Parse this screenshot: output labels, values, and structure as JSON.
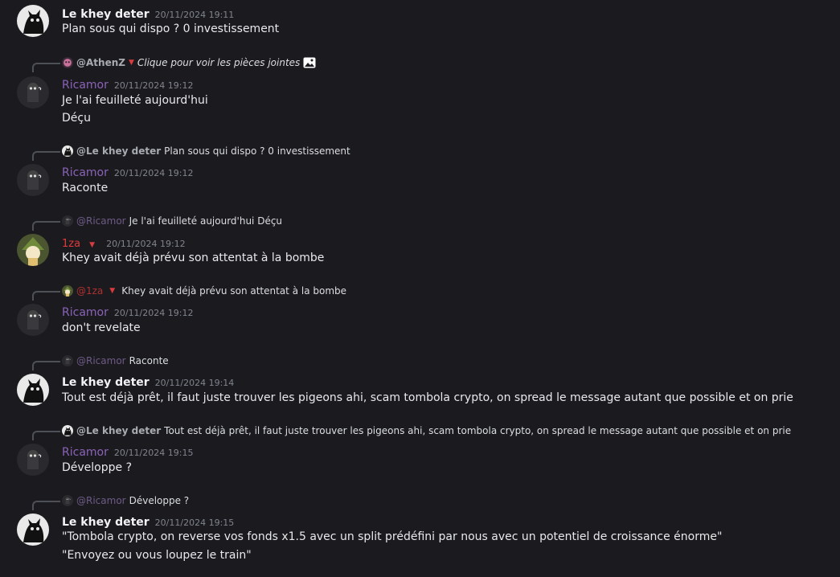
{
  "messages": [
    {
      "author": "Le khey deter",
      "time": "20/11/2024 19:11",
      "lines": [
        "Plan sous qui dispo ? 0 investissement"
      ]
    },
    {
      "reply": {
        "name": "@AthenZ",
        "text": "Clique pour voir les pièces jointes"
      },
      "author": "Ricamor",
      "time": "20/11/2024 19:12",
      "lines": [
        "Je l'ai feuilleté aujourd'hui",
        "Déçu"
      ]
    },
    {
      "reply": {
        "name": "@Le khey deter",
        "text": "Plan sous qui dispo ? 0 investissement"
      },
      "author": "Ricamor",
      "time": "20/11/2024 19:12",
      "lines": [
        "Raconte"
      ]
    },
    {
      "reply": {
        "name": "@Ricamor",
        "text": "Je l'ai feuilleté aujourd'hui Déçu"
      },
      "author": "1za",
      "time": "20/11/2024 19:12",
      "lines": [
        "Khey avait déjà prévu son attentat à la bombe"
      ]
    },
    {
      "reply": {
        "name": "@1za",
        "text": "Khey avait déjà prévu son attentat à la bombe"
      },
      "author": "Ricamor",
      "time": "20/11/2024 19:12",
      "lines": [
        "don't revelate"
      ]
    },
    {
      "reply": {
        "name": "@Ricamor",
        "text": "Raconte"
      },
      "author": "Le khey deter",
      "time": "20/11/2024 19:14",
      "lines": [
        "Tout est déjà prêt, il faut juste trouver les pigeons ahi, scam tombola crypto, on spread le message autant que possible et on prie"
      ]
    },
    {
      "reply": {
        "name": "@Le khey deter",
        "text": "Tout est déjà prêt, il faut juste trouver les pigeons ahi, scam tombola crypto, on spread le message autant que possible et on prie"
      },
      "author": "Ricamor",
      "time": "20/11/2024 19:15",
      "lines": [
        "Développe ?"
      ]
    },
    {
      "reply": {
        "name": "@Ricamor",
        "text": "Développe ?"
      },
      "author": "Le khey deter",
      "time": "20/11/2024 19:15",
      "lines": [
        "\"Tombola crypto, on reverse vos fonds x1.5 avec un split prédéfini par nous avec un potentiel de croissance énorme\"",
        "\"Envoyez ou vous loupez le train\""
      ]
    }
  ],
  "colors": {
    "background": "#1b1b1f",
    "ricamor": "#8b63b8",
    "iza": "#e03a3a",
    "text": "#e8e9eb",
    "timestamp": "#80848e"
  }
}
